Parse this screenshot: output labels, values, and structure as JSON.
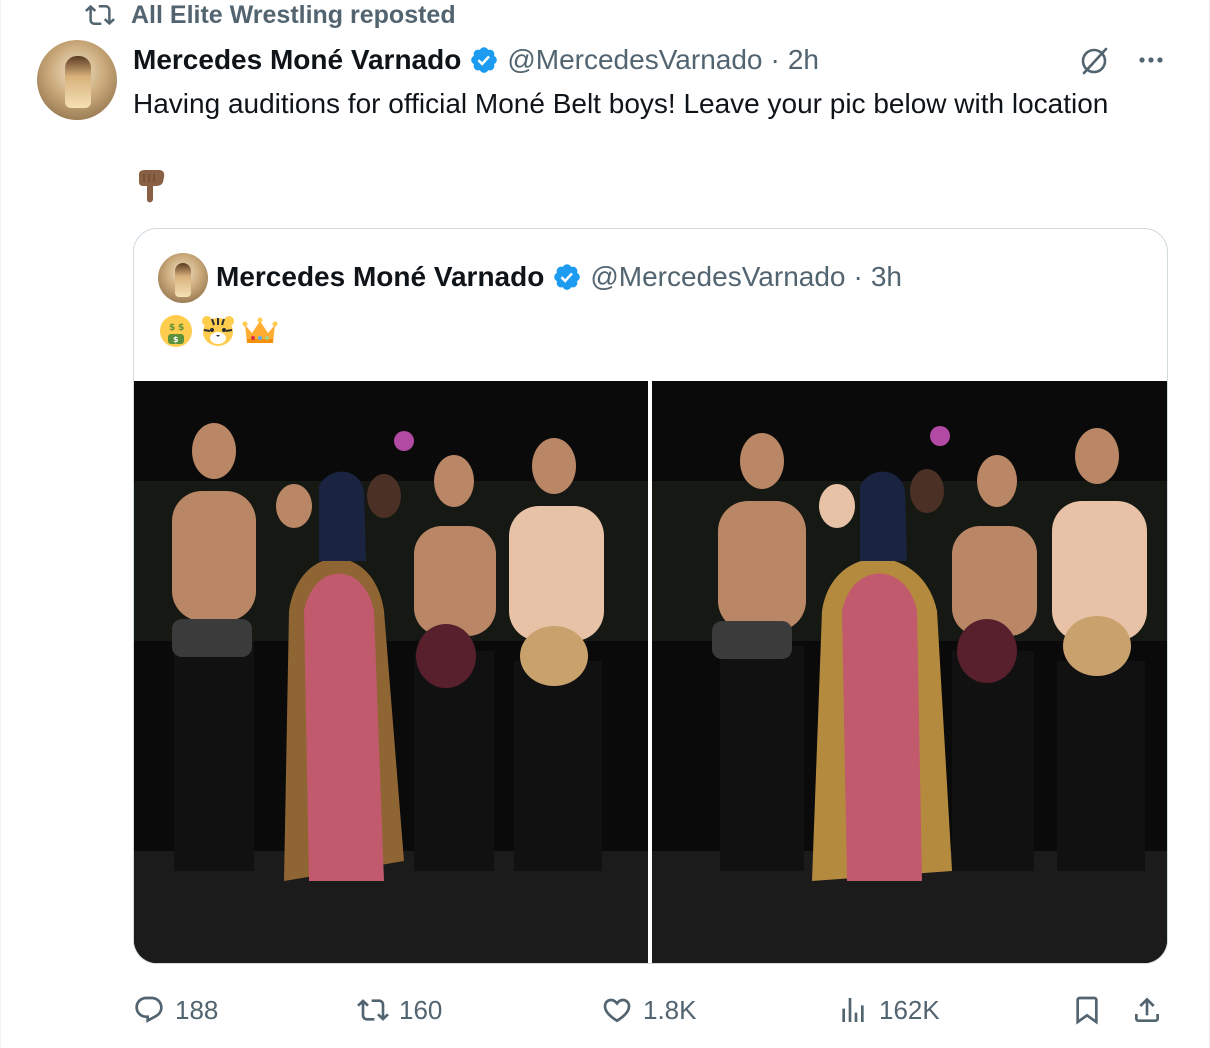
{
  "repost": {
    "text": "All Elite Wrestling reposted"
  },
  "tweet": {
    "author_name": "Mercedes Moné Varnado",
    "handle": "@MercedesVarnado",
    "separator": "·",
    "time": "2h",
    "text": "Having auditions for official Moné Belt boys! Leave your pic below with location",
    "emoji": "backhand-index-pointing-down"
  },
  "quoted": {
    "author_name": "Mercedes Moné Varnado",
    "handle": "@MercedesVarnado",
    "separator": "·",
    "time": "3h",
    "emojis": [
      "money-mouth-face",
      "tiger-face",
      "crown"
    ],
    "photo_count": 2
  },
  "stats": {
    "replies": "188",
    "reposts": "160",
    "likes": "1.8K",
    "views": "162K"
  },
  "colors": {
    "text": "#0f1419",
    "secondary": "#536471",
    "verified": "#1d9bf0",
    "border": "#cfd9de"
  }
}
